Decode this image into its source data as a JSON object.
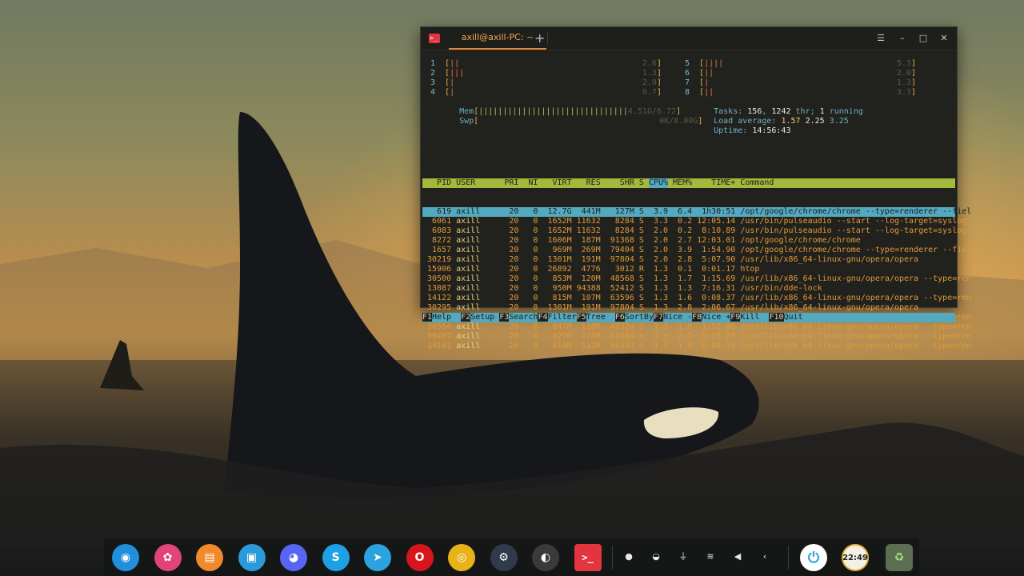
{
  "window": {
    "tab_title": "axill@axill-PC: ~",
    "new_tab": "+",
    "menu_glyph": "☰",
    "minimize_glyph": "–",
    "maximize_glyph": "□",
    "close_glyph": "✕",
    "app_icon_glyph": ">_"
  },
  "htop": {
    "cpus_left": [
      {
        "num": "1",
        "bar": "||",
        "pct": "2.6"
      },
      {
        "num": "2",
        "bar": "|||",
        "pct": "1.3"
      },
      {
        "num": "3",
        "bar": "|",
        "pct": "2.0"
      },
      {
        "num": "4",
        "bar": "|",
        "pct": "0.7"
      }
    ],
    "cpus_right": [
      {
        "num": "5",
        "bar": "||||",
        "pct": "5.3"
      },
      {
        "num": "6",
        "bar": "||",
        "pct": "2.0"
      },
      {
        "num": "7",
        "bar": "|",
        "pct": "1.3"
      },
      {
        "num": "8",
        "bar": "||",
        "pct": "3.3"
      }
    ],
    "mem": {
      "label": "Mem",
      "bar": "|||||||||||||||||||||||||||||||",
      "value": "4.51G/6.72"
    },
    "swp": {
      "label": "Swp",
      "bar": "",
      "value": "0K/8.00G"
    },
    "tasks": {
      "label": "Tasks:",
      "count": "156",
      "sep": ",",
      "thr": "1242",
      "thr_label": "thr;",
      "running": "1",
      "running_label": "running"
    },
    "load": {
      "label": "Load average:",
      "v1": "1.57",
      "v5": "2.25",
      "v15": "3.25"
    },
    "uptime": {
      "label": "Uptime:",
      "value": "14:56:43"
    },
    "header": {
      "pid": "PID",
      "user": "USER",
      "pri": "PRI",
      "ni": "NI",
      "virt": "VIRT",
      "res": "RES",
      "shr": "SHR",
      "s": "S",
      "cpu": "CPU%",
      "mem": "MEM%",
      "time": "TIME+",
      "cmd": "Command"
    },
    "processes": [
      {
        "pid": "619",
        "user": "axill",
        "pri": "20",
        "ni": "0",
        "virt": "12.7G",
        "res": "441M",
        "shr": "127M",
        "s": "S",
        "cpu": "3.9",
        "mem": "6.4",
        "time": "1h30:51",
        "cmd": "/opt/google/chrome/chrome --type=renderer --fiel"
      },
      {
        "pid": "6061",
        "user": "axill",
        "pri": "20",
        "ni": "0",
        "virt": "1652M",
        "res": "11632",
        "shr": "8284",
        "s": "S",
        "cpu": "3.3",
        "mem": "0.2",
        "time": "12:05.14",
        "cmd": "/usr/bin/pulseaudio --start --log-target=syslog"
      },
      {
        "pid": "6083",
        "user": "axill",
        "pri": "20",
        "ni": "0",
        "virt": "1652M",
        "res": "11632",
        "shr": "8284",
        "s": "S",
        "cpu": "2.0",
        "mem": "0.2",
        "time": "8:10.89",
        "cmd": "/usr/bin/pulseaudio --start --log-target=syslog"
      },
      {
        "pid": "8272",
        "user": "axill",
        "pri": "20",
        "ni": "0",
        "virt": "1606M",
        "res": "187M",
        "shr": "91368",
        "s": "S",
        "cpu": "2.0",
        "mem": "2.7",
        "time": "12:03.01",
        "cmd": "/opt/google/chrome/chrome"
      },
      {
        "pid": "1657",
        "user": "axill",
        "pri": "20",
        "ni": "0",
        "virt": "969M",
        "res": "269M",
        "shr": "79404",
        "s": "S",
        "cpu": "2.0",
        "mem": "3.9",
        "time": "1:54.90",
        "cmd": "/opt/google/chrome/chrome --type=renderer --fiel"
      },
      {
        "pid": "30219",
        "user": "axill",
        "pri": "20",
        "ni": "0",
        "virt": "1301M",
        "res": "191M",
        "shr": "97804",
        "s": "S",
        "cpu": "2.0",
        "mem": "2.8",
        "time": "5:07.90",
        "cmd": "/usr/lib/x86_64-linux-gnu/opera/opera"
      },
      {
        "pid": "15906",
        "user": "axill",
        "pri": "20",
        "ni": "0",
        "virt": "26892",
        "res": "4776",
        "shr": "3012",
        "s": "R",
        "cpu": "1.3",
        "mem": "0.1",
        "time": "0:01.17",
        "cmd": "htop"
      },
      {
        "pid": "30500",
        "user": "axill",
        "pri": "20",
        "ni": "0",
        "virt": "853M",
        "res": "120M",
        "shr": "48568",
        "s": "S",
        "cpu": "1.3",
        "mem": "1.7",
        "time": "1:15.69",
        "cmd": "/usr/lib/x86_64-linux-gnu/opera/opera --type=ren"
      },
      {
        "pid": "13087",
        "user": "axill",
        "pri": "20",
        "ni": "0",
        "virt": "950M",
        "res": "94388",
        "shr": "52412",
        "s": "S",
        "cpu": "1.3",
        "mem": "1.3",
        "time": "7:16.31",
        "cmd": "/usr/bin/dde-lock"
      },
      {
        "pid": "14122",
        "user": "axill",
        "pri": "20",
        "ni": "0",
        "virt": "815M",
        "res": "107M",
        "shr": "63596",
        "s": "S",
        "cpu": "1.3",
        "mem": "1.6",
        "time": "0:08.37",
        "cmd": "/usr/lib/x86_64-linux-gnu/opera/opera --type=ren"
      },
      {
        "pid": "30295",
        "user": "axill",
        "pri": "20",
        "ni": "0",
        "virt": "1301M",
        "res": "191M",
        "shr": "97804",
        "s": "S",
        "cpu": "1.3",
        "mem": "2.8",
        "time": "2:06.67",
        "cmd": "/usr/lib/x86_64-linux-gnu/opera/opera"
      },
      {
        "pid": "13861",
        "user": "axill",
        "pri": "20",
        "ni": "0",
        "virt": "844M",
        "res": "128M",
        "shr": "67156",
        "s": "S",
        "cpu": "1.3",
        "mem": "1.9",
        "time": "0:17.66",
        "cmd": "/usr/lib/x86_64-linux-gnu/opera/opera --type=ren"
      },
      {
        "pid": "30564",
        "user": "axill",
        "pri": "20",
        "ni": "0",
        "virt": "847M",
        "res": "110M",
        "shr": "47324",
        "s": "S",
        "cpu": "1.3",
        "mem": "1.6",
        "time": "1:12.08",
        "cmd": "/usr/lib/x86_64-linux-gnu/opera/opera --type=ren"
      },
      {
        "pid": "30487",
        "user": "axill",
        "pri": "20",
        "ni": "0",
        "virt": "927M",
        "res": "175M",
        "shr": "61444",
        "s": "S",
        "cpu": "1.3",
        "mem": "2.5",
        "time": "8:28.87",
        "cmd": "/usr/lib/x86_64-linux-gnu/opera/opera --type=ren"
      },
      {
        "pid": "14181",
        "user": "axill",
        "pri": "20",
        "ni": "0",
        "virt": "816M",
        "res": "111M",
        "shr": "66392",
        "s": "S",
        "cpu": "1.3",
        "mem": "1.6",
        "time": "0:08.55",
        "cmd": "/usr/lib/x86_64-linux-gnu/opera/opera --type=ren"
      }
    ],
    "fkeys": [
      {
        "key": "F1",
        "label": "Help"
      },
      {
        "key": "F2",
        "label": "Setup"
      },
      {
        "key": "F3",
        "label": "Search"
      },
      {
        "key": "F4",
        "label": "Filter"
      },
      {
        "key": "F5",
        "label": "Tree"
      },
      {
        "key": "F6",
        "label": "SortBy"
      },
      {
        "key": "F7",
        "label": "Nice -"
      },
      {
        "key": "F8",
        "label": "Nice +"
      },
      {
        "key": "F9",
        "label": "Kill"
      },
      {
        "key": "F10",
        "label": "Quit"
      }
    ]
  },
  "dock": {
    "apps": [
      {
        "name": "deepin-launcher-icon",
        "glyph": "◉",
        "color": "#1f8fde"
      },
      {
        "name": "control-center-icon",
        "glyph": "✿",
        "color": "#e0447a"
      },
      {
        "name": "app-store-icon",
        "glyph": "▤",
        "color": "#f08a2a"
      },
      {
        "name": "file-manager-icon",
        "glyph": "▣",
        "color": "#2a9ad8"
      },
      {
        "name": "discord-icon",
        "glyph": "◕",
        "color": "#5865f2"
      },
      {
        "name": "skype-icon",
        "glyph": "S",
        "color": "#1ea0e6"
      },
      {
        "name": "telegram-icon",
        "glyph": "➤",
        "color": "#2aa3e0"
      },
      {
        "name": "opera-icon",
        "glyph": "O",
        "color": "#d8141c"
      },
      {
        "name": "chrome-icon",
        "glyph": "◎",
        "color": "#e8b21a"
      },
      {
        "name": "steam-icon",
        "glyph": "⚙",
        "color": "#2f3a4a"
      },
      {
        "name": "obs-icon",
        "glyph": "◐",
        "color": "#3a3a3a"
      },
      {
        "name": "terminal-icon",
        "glyph": ">_",
        "color": "#e2353f"
      }
    ],
    "tray": [
      {
        "name": "tray-dot-icon",
        "glyph": "●"
      },
      {
        "name": "tray-chat-icon",
        "glyph": "◒"
      },
      {
        "name": "usb-icon",
        "glyph": "⏚"
      },
      {
        "name": "wifi-icon",
        "glyph": "≋"
      },
      {
        "name": "volume-icon",
        "glyph": "◀"
      },
      {
        "name": "tray-expand-icon",
        "glyph": "‹"
      }
    ],
    "power_glyph": "⏻",
    "clock": "22:49",
    "trash_glyph": "♻"
  }
}
